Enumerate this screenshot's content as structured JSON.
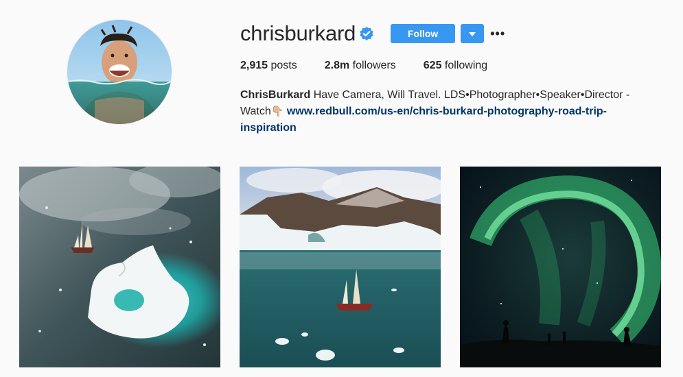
{
  "profile": {
    "username": "chrisburkard",
    "verified": true,
    "follow_label": "Follow",
    "more_label": "•••"
  },
  "stats": {
    "posts_count": "2,915",
    "posts_label": " posts",
    "followers_count": "2.8m",
    "followers_label": " followers",
    "following_count": "625",
    "following_label": " following"
  },
  "bio": {
    "name": "ChrisBurkard",
    "text": " Have Camera, Will Travel. LDS•Photographer•Speaker•Director - Watch",
    "hand_emoji": "👇🏼",
    "link": "www.redbull.com/us-en/chris-burkard-photography-road-trip-inspiration"
  },
  "colors": {
    "follow_blue": "#3897f0",
    "link_blue": "#003569",
    "verified_blue": "#3897f0",
    "background": "#fafafa"
  },
  "icons": {
    "verified": "verified-badge-icon",
    "dropdown": "chevron-down-icon",
    "more": "more-options-icon"
  },
  "posts": [
    {
      "subject": "sailboat near iceberg aerial"
    },
    {
      "subject": "sailboat in fjord with icebergs"
    },
    {
      "subject": "northern lights over silhouettes"
    }
  ]
}
